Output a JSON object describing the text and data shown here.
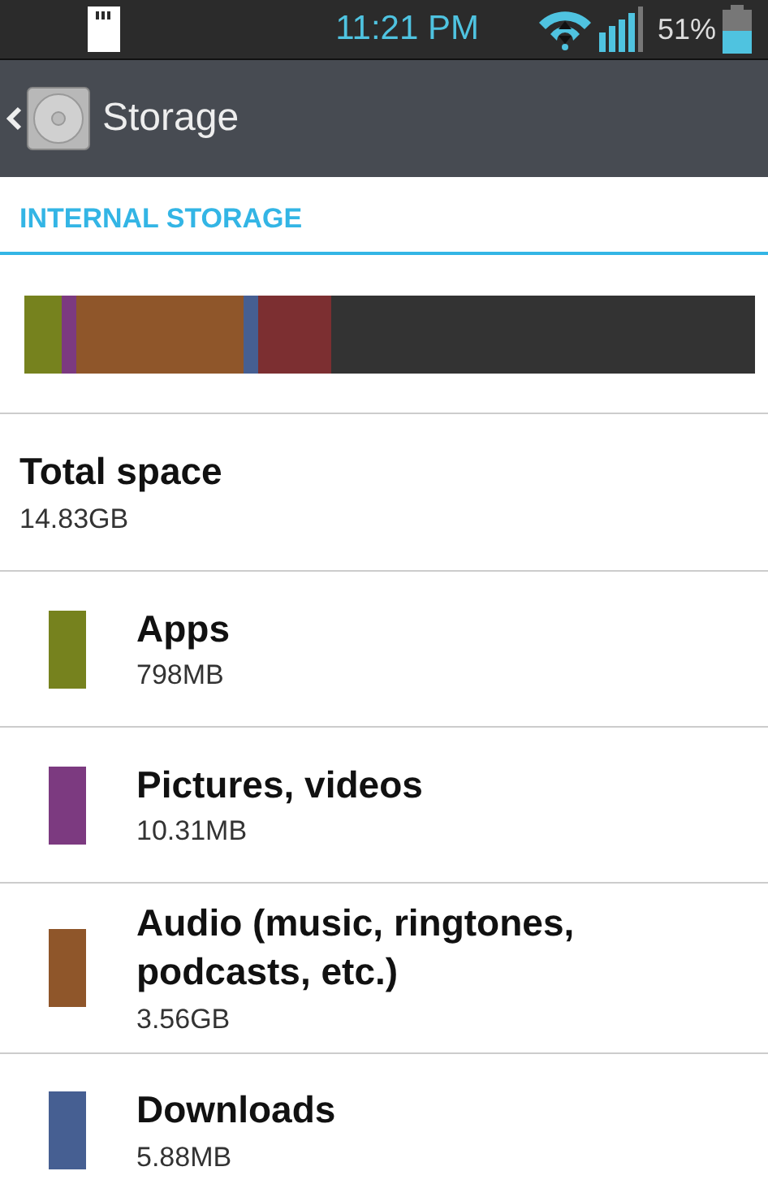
{
  "status_bar": {
    "time": "11:21 PM",
    "battery": "51%"
  },
  "action_bar": {
    "title": "Storage"
  },
  "section": {
    "title": "INTERNAL STORAGE"
  },
  "usage_bar": {
    "segments": [
      {
        "color": "#76821e"
      },
      {
        "color": "#7c3a80"
      },
      {
        "color": "#8f562a"
      },
      {
        "color": "#465f92"
      },
      {
        "color": "#7c2f31"
      }
    ]
  },
  "total": {
    "label": "Total space",
    "value": "14.83GB"
  },
  "items": [
    {
      "name": "Apps",
      "value": "798MB",
      "color": "#76821e"
    },
    {
      "name": "Pictures, videos",
      "value": "10.31MB",
      "color": "#7c3a80"
    },
    {
      "name": "Audio (music, ringtones, podcasts, etc.)",
      "value": "3.56GB",
      "color": "#8f562a"
    },
    {
      "name": "Downloads",
      "value": "5.88MB",
      "color": "#465f92"
    }
  ]
}
